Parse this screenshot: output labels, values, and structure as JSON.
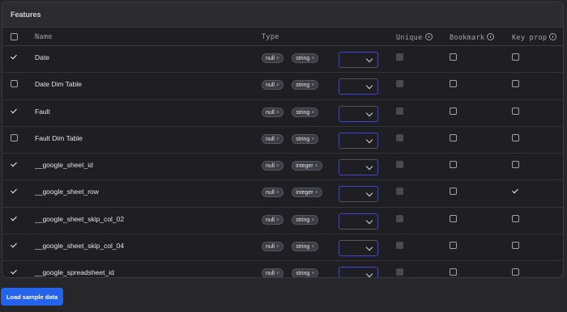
{
  "panel": {
    "title": "Features"
  },
  "table": {
    "headers": {
      "name": "Name",
      "type": "Type",
      "unique": "Unique",
      "bookmark": "Bookmark",
      "key_prop": "Key prop"
    },
    "rows": [
      {
        "checked": true,
        "name": "Date",
        "types": [
          "null",
          "string"
        ],
        "unique": false,
        "bookmark": false,
        "key_prop": false
      },
      {
        "checked": false,
        "name": "Date Dim Table",
        "types": [
          "null",
          "string"
        ],
        "unique": false,
        "bookmark": false,
        "key_prop": false
      },
      {
        "checked": true,
        "name": "Fault",
        "types": [
          "null",
          "string"
        ],
        "unique": false,
        "bookmark": false,
        "key_prop": false
      },
      {
        "checked": false,
        "name": "Fault Dim Table",
        "types": [
          "null",
          "string"
        ],
        "unique": false,
        "bookmark": false,
        "key_prop": false
      },
      {
        "checked": true,
        "name": "__google_sheet_id",
        "types": [
          "null",
          "integer"
        ],
        "unique": false,
        "bookmark": false,
        "key_prop": false
      },
      {
        "checked": true,
        "name": "__google_sheet_row",
        "types": [
          "null",
          "integer"
        ],
        "unique": false,
        "bookmark": false,
        "key_prop": true
      },
      {
        "checked": true,
        "name": "__google_sheet_skip_col_02",
        "types": [
          "null",
          "string"
        ],
        "unique": false,
        "bookmark": false,
        "key_prop": false
      },
      {
        "checked": true,
        "name": "__google_sheet_skip_col_04",
        "types": [
          "null",
          "string"
        ],
        "unique": false,
        "bookmark": false,
        "key_prop": false
      },
      {
        "checked": true,
        "name": "__google_spreadsheet_id",
        "types": [
          "null",
          "string"
        ],
        "unique": false,
        "bookmark": false,
        "key_prop": false
      }
    ]
  },
  "actions": {
    "load_sample_label": "Load sample data"
  },
  "colors": {
    "accent": "#2563eb",
    "select_border": "#4b4b9c"
  },
  "icons": {
    "remove_chip": "close-icon",
    "select": "chevron-down-icon",
    "info": "info-icon"
  }
}
